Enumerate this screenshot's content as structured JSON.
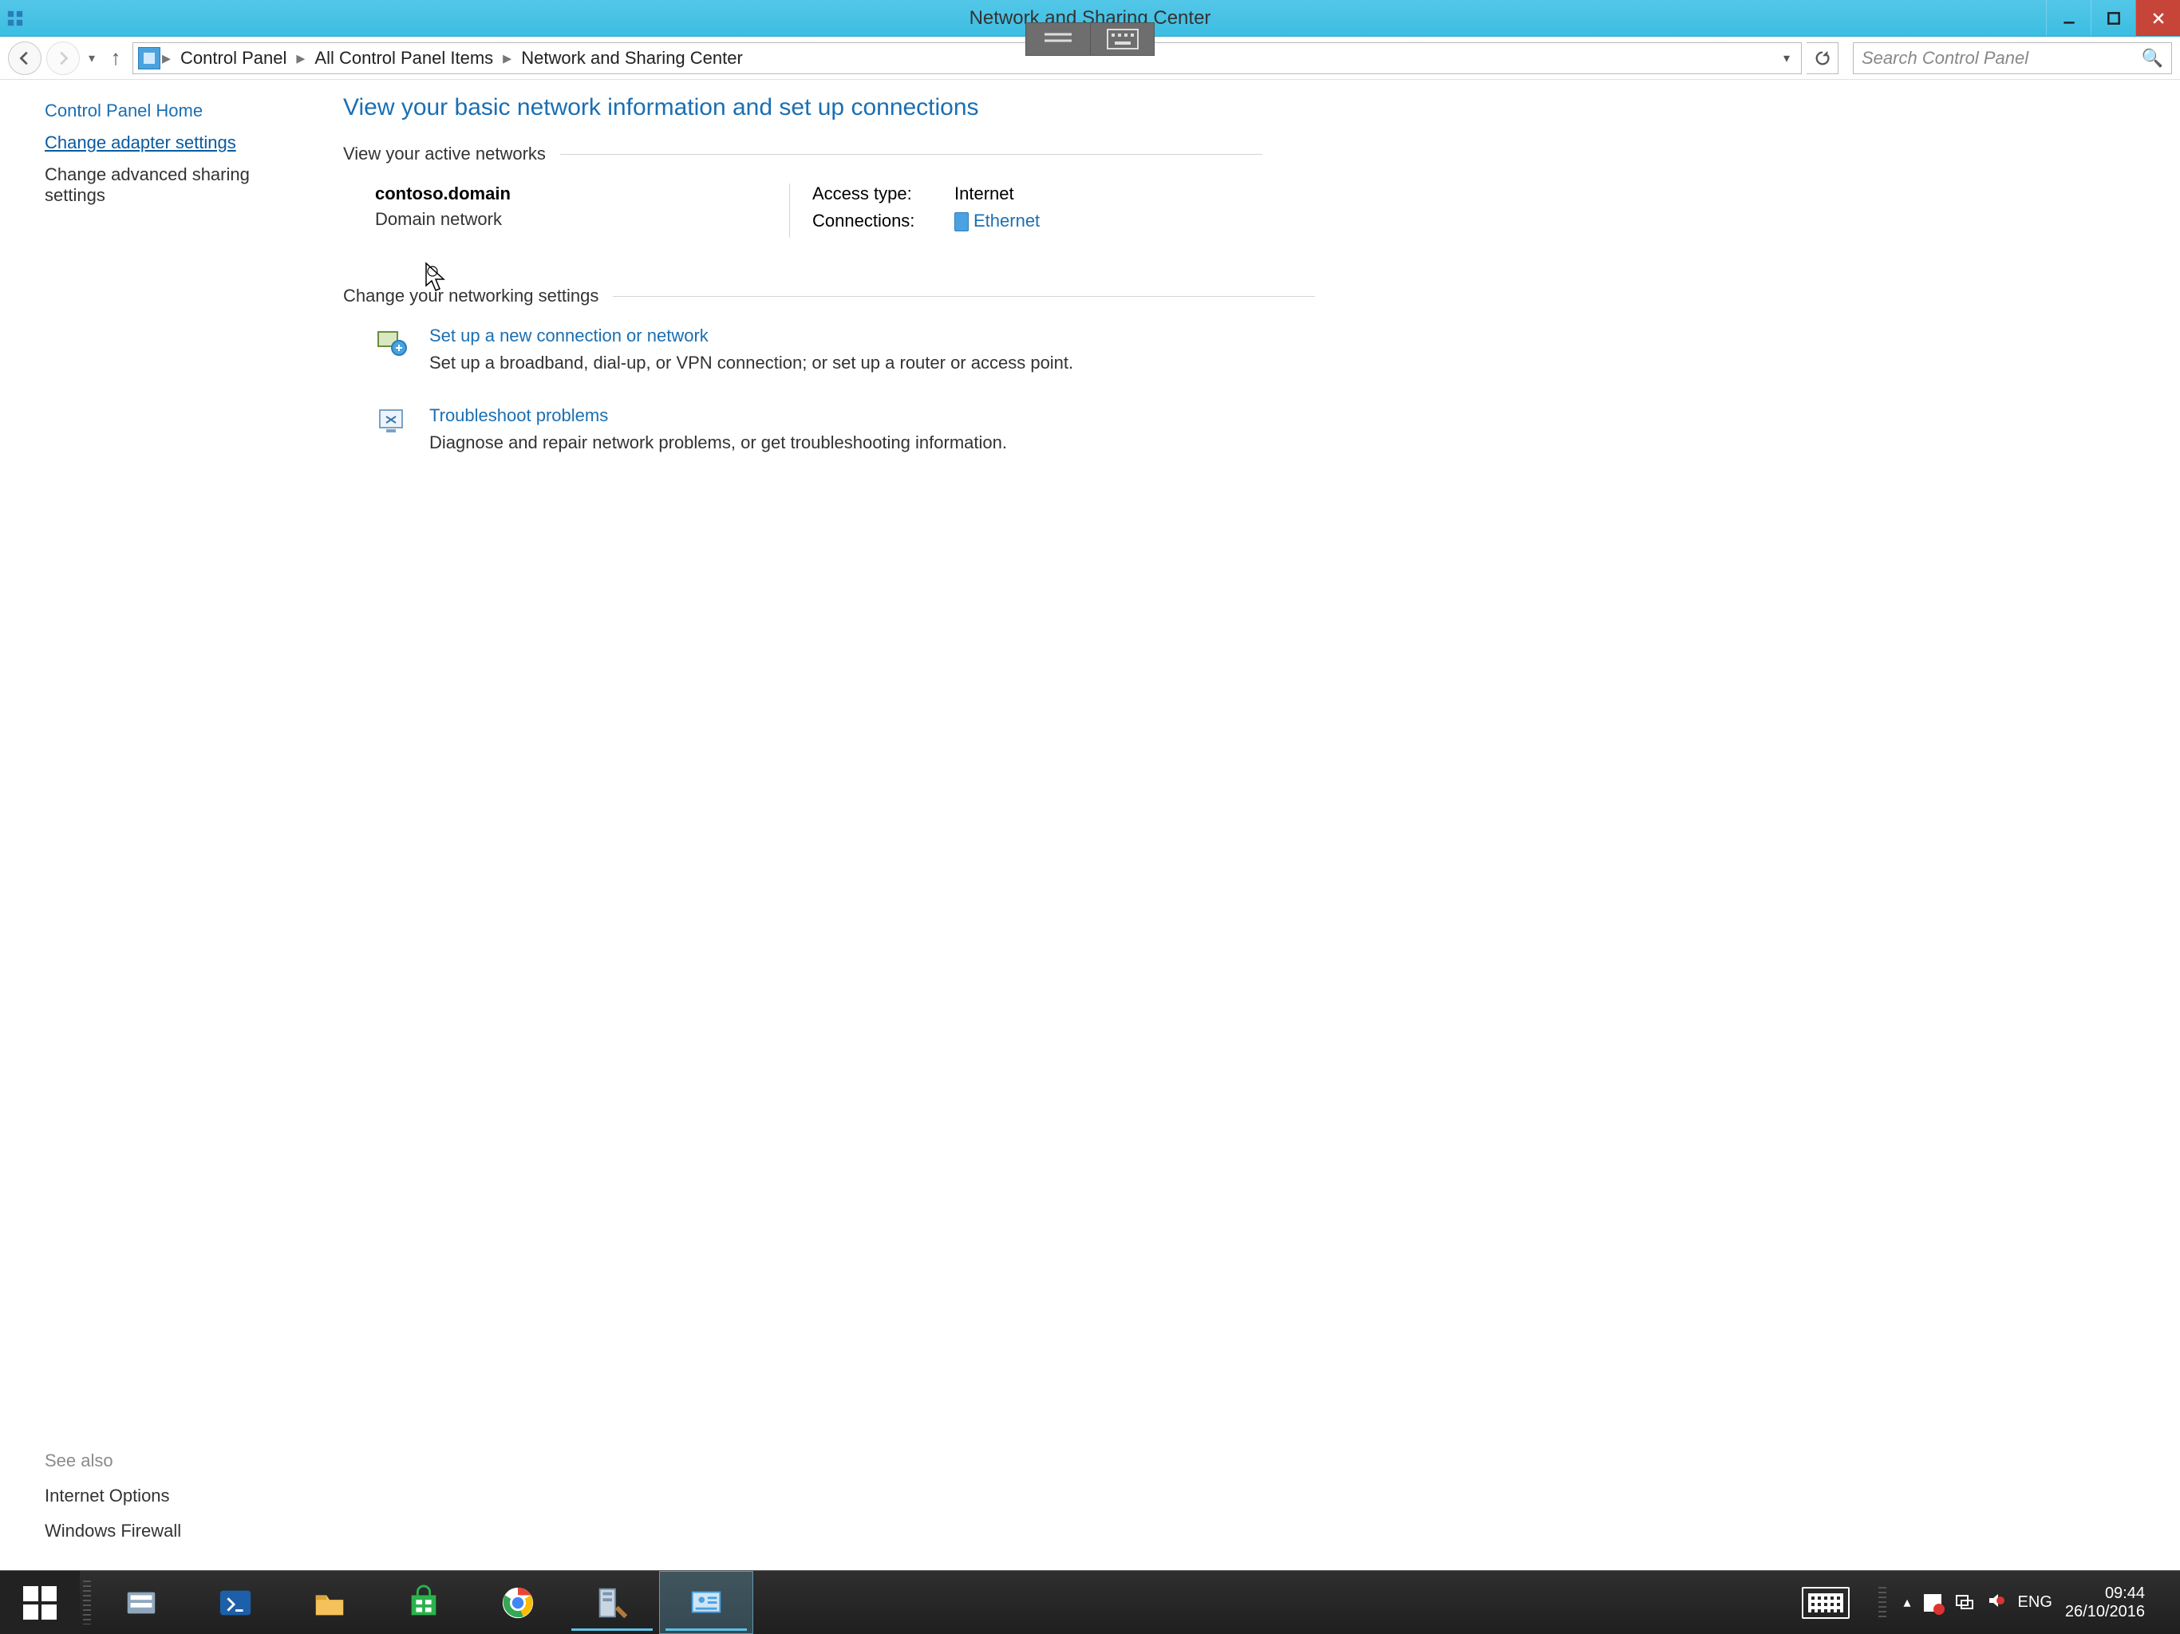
{
  "window": {
    "title": "Network and Sharing Center"
  },
  "breadcrumb": {
    "items": [
      "Control Panel",
      "All Control Panel Items",
      "Network and Sharing Center"
    ]
  },
  "search": {
    "placeholder": "Search Control Panel"
  },
  "sidebar": {
    "home": "Control Panel Home",
    "links": [
      {
        "label": "Change adapter settings",
        "active": true
      },
      {
        "label": "Change advanced sharing settings",
        "active": false
      }
    ],
    "see_also_header": "See also",
    "see_also": [
      "Internet Options",
      "Windows Firewall"
    ]
  },
  "main": {
    "heading": "View your basic network information and set up connections",
    "active_networks_header": "View your active networks",
    "network": {
      "name": "contoso.domain",
      "type": "Domain network",
      "access_type_label": "Access type:",
      "access_type_value": "Internet",
      "connections_label": "Connections:",
      "connections_value": "Ethernet"
    },
    "change_settings_header": "Change your networking settings",
    "tasks": [
      {
        "title": "Set up a new connection or network",
        "desc": "Set up a broadband, dial-up, or VPN connection; or set up a router or access point."
      },
      {
        "title": "Troubleshoot problems",
        "desc": "Diagnose and repair network problems, or get troubleshooting information."
      }
    ]
  },
  "tray": {
    "lang": "ENG",
    "time": "09:44",
    "date": "26/10/2016"
  }
}
